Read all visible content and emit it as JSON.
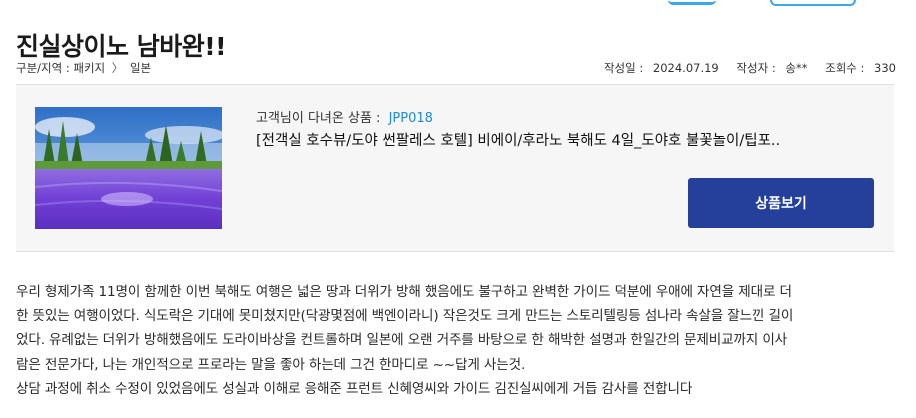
{
  "review": {
    "title": "진실상이노 남바완!!",
    "breadcrumb": {
      "label": "구분/지역 :",
      "category": "패키지",
      "region": "일본"
    },
    "meta": {
      "date_label": "작성일 :",
      "date": "2024.07.19",
      "author_label": "작성자 :",
      "author": "송**",
      "views_label": "조회수 :",
      "views": "330"
    }
  },
  "product": {
    "code_label": "고객님이 다녀온 상품 :",
    "code": "JPP018",
    "name": "[전객실 호수뷰/도야 썬팔레스 호텔] 비에이/후라노 북해도 4일_도야호 불꽃놀이/팁포..",
    "button_label": "상품보기",
    "image_alt_colors": {
      "sky": "#3a7fd0",
      "lavender": "#7b4fd8",
      "trees": "#3e7a2a"
    }
  },
  "body": {
    "lines": [
      "우리 형제가족 11명이 함께한 이번 북해도 여행은 넓은 땅과 더위가 방해 했음에도 불구하고 완벽한 가이드 덕분에 우애에 자연을 제대로 더",
      "한 뜻있는 여행이었다. 식도락은 기대에 못미쳤지만(닥광몇점에 백엔이라니) 작은것도 크게 만드는 스토리텔링등 섬나라 속살을 잘느낀 길이",
      "었다. 유례없는 더위가 방해했음에도 도라이바상을 컨트롤하며 일본에 오랜 거주를 바탕으로 한 해박한 설명과 한일간의 문제비교까지 이사",
      "람은 전문가다, 나는 개인적으로 프로라는 말을 좋아 하는데 그건 한마디로 ~~답게 사는것.",
      "상담 과정에 취소 수정이 있었음에도 성실과 이해로 응해준 프런트 신혜영씨와 가이드 김진실씨에게 거듭 감사를 전합니다"
    ]
  }
}
